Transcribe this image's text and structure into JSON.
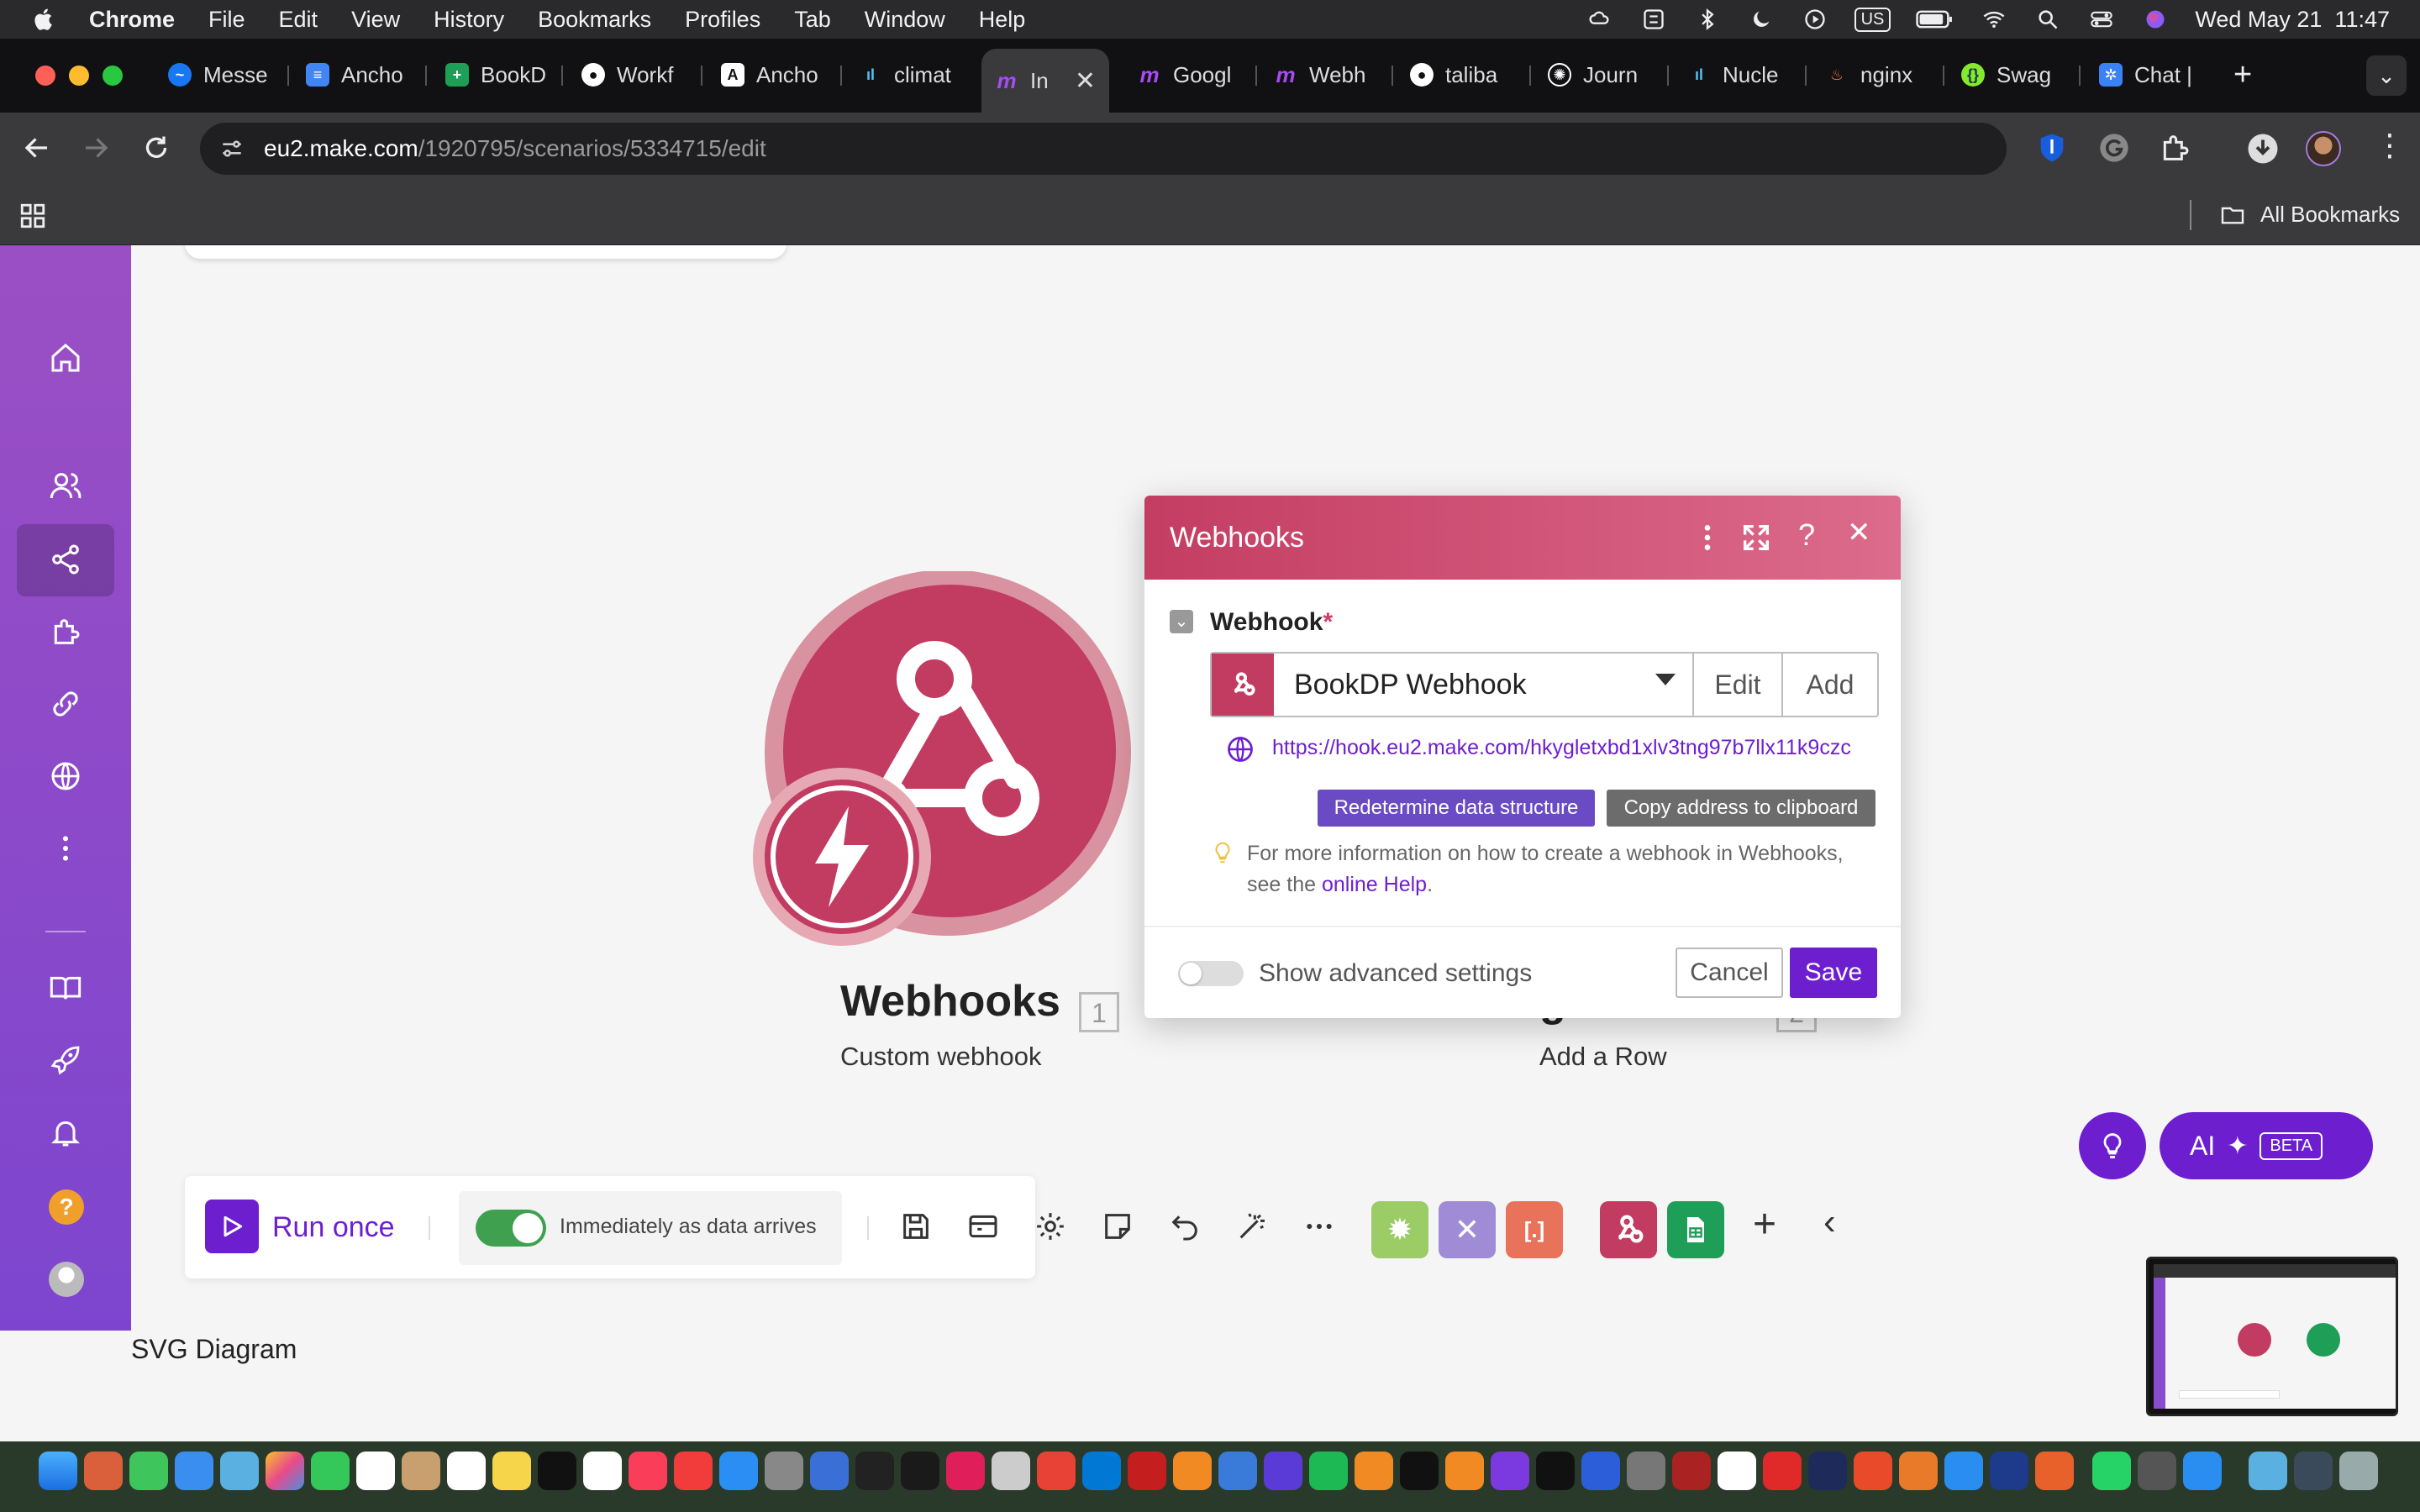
{
  "menubar": {
    "app": "Chrome",
    "items": [
      "File",
      "Edit",
      "View",
      "History",
      "Bookmarks",
      "Profiles",
      "Tab",
      "Window",
      "Help"
    ],
    "keyboard": "US",
    "clock": "Wed May 21  11:47"
  },
  "tabs": [
    {
      "title": "Messe",
      "icon": "messenger-icon",
      "color": "#1877f2"
    },
    {
      "title": "Ancho",
      "icon": "docs-icon",
      "color": "#4285f4"
    },
    {
      "title": "BookD",
      "icon": "sheets-icon",
      "color": "#1e9e57"
    },
    {
      "title": "Workf",
      "icon": "github-icon",
      "color": "#ffffff"
    },
    {
      "title": "Ancho",
      "icon": "anthropic-icon",
      "color": "#ffffff"
    },
    {
      "title": "climat",
      "icon": "chart-icon",
      "color": "#4fc3f7"
    },
    {
      "title": "In",
      "icon": "make-icon",
      "color": "#a64cf0",
      "active": true
    },
    {
      "title": "Googl",
      "icon": "make-icon",
      "color": "#a64cf0"
    },
    {
      "title": "Webh",
      "icon": "make-icon",
      "color": "#a64cf0"
    },
    {
      "title": "taliba",
      "icon": "github-icon",
      "color": "#ffffff"
    },
    {
      "title": "Journ",
      "icon": "openai-icon",
      "color": "#ffffff"
    },
    {
      "title": "Nucle",
      "icon": "chart-icon",
      "color": "#4fc3f7"
    },
    {
      "title": "nginx",
      "icon": "flame-icon",
      "color": "#ff7043"
    },
    {
      "title": "Swag",
      "icon": "swagger-icon",
      "color": "#85ea2d"
    },
    {
      "title": "Chat |",
      "icon": "chat-icon",
      "color": "#3b82f6"
    }
  ],
  "address": {
    "host": "eu2.make.com",
    "path": "/1920795/scenarios/5334715/edit"
  },
  "bookmarks": {
    "all_label": "All Bookmarks"
  },
  "modules": {
    "webhooks": {
      "title": "Webhooks",
      "number": "1",
      "subtitle": "Custom webhook"
    },
    "sheets": {
      "title": "Google Sheets",
      "number": "2",
      "subtitle": "Add a Row"
    }
  },
  "dialog": {
    "title": "Webhooks",
    "field_label": "Webhook",
    "required_mark": "*",
    "selected_webhook": "BookDP Webhook",
    "edit_label": "Edit",
    "add_label": "Add",
    "url": "https://hook.eu2.make.com/hkygletxbd1xlv3tng97b7llx11k9czc",
    "redetermine_label": "Redetermine data structure",
    "copy_label": "Copy address to clipboard",
    "help_text": "For more information on how to create a webhook in Webhooks,",
    "help_text2": "see the",
    "help_link": "online Help",
    "help_end": ".",
    "advanced_label": "Show advanced settings",
    "advanced_on": false,
    "cancel_label": "Cancel",
    "save_label": "Save"
  },
  "toolbar": {
    "run_label": "Run once",
    "schedule_label": "Immediately as data arrives",
    "schedule_on": true
  },
  "ai": {
    "label": "AI",
    "badge": "BETA"
  },
  "caption": "SVG Diagram",
  "colors": {
    "make_purple": "#6d1fd0",
    "webhook_red": "#c2365e",
    "sheets_green": "#1e9e57",
    "toggle_green": "#3fa14f"
  }
}
